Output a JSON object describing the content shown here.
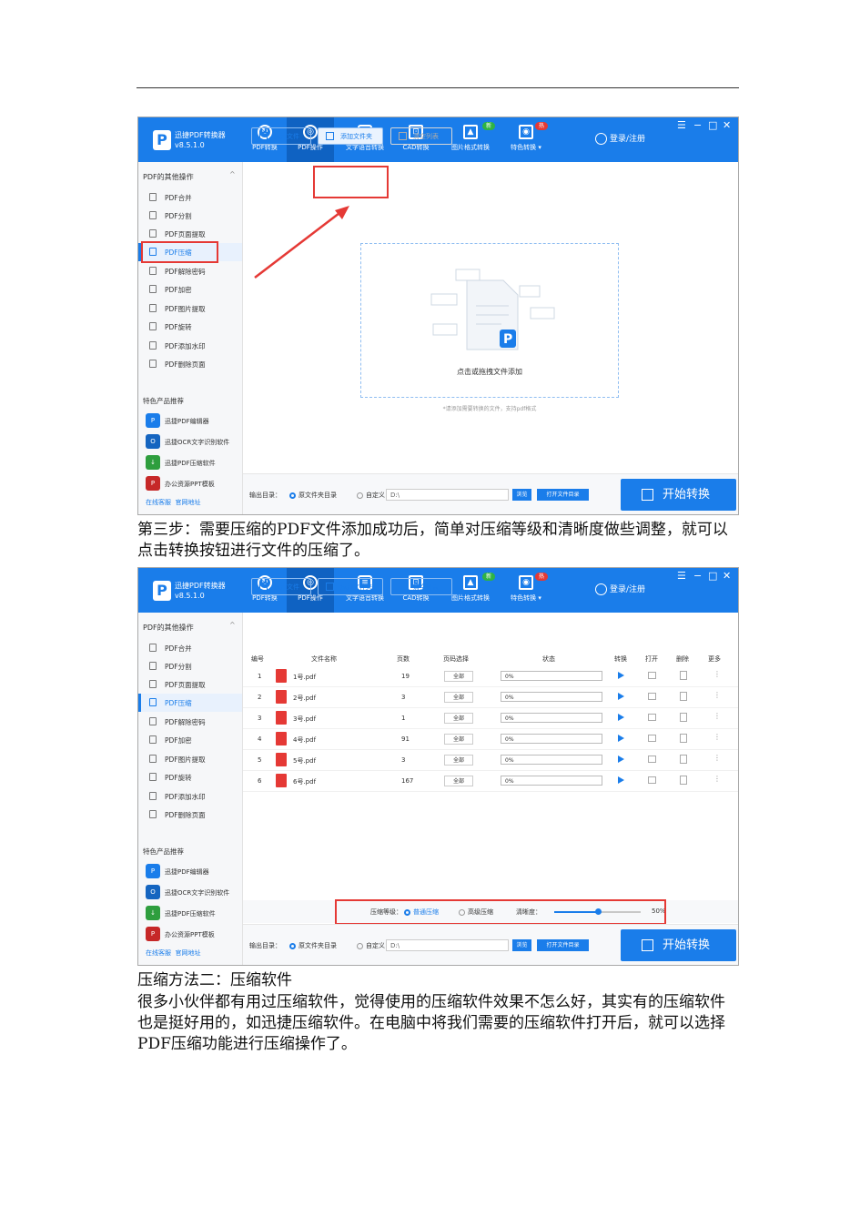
{
  "app": {
    "name": "迅捷PDF转换器",
    "version": "v8.5.1.0",
    "nav": [
      "PDF转换",
      "PDF操作",
      "文字语音转换",
      "CAD转换",
      "图片格式转换",
      "特色转换 ▾"
    ],
    "tags": [
      "新",
      "热"
    ],
    "user": "登录/注册",
    "window_controls": [
      "☰",
      "−",
      "□",
      "✕"
    ],
    "sidebar_title": "PDF的其他操作",
    "sidebar_items": [
      "PDF合并",
      "PDF分割",
      "PDF页面提取",
      "PDF压缩",
      "PDF解除密码",
      "PDF加密",
      "PDF图片提取",
      "PDF旋转",
      "PDF添加水印",
      "PDF删除页面"
    ],
    "rec_title": "特色产品推荐",
    "rec_items": [
      "迅捷PDF编辑器",
      "迅捷OCR文字识别软件",
      "迅捷PDF压缩软件",
      "办公资源PPT模板"
    ],
    "links": [
      "在线客服",
      "官网地址"
    ],
    "toolbar": {
      "add_file": "添加文件",
      "add_folder": "添加文件夹",
      "clear": "清空列表"
    },
    "drop_text": "点击或拖拽文件添加",
    "drop_hint": "*请添加需要转换的文件，支持pdf格式",
    "output_label": "输出目录：",
    "radio_src": "原文件夹目录",
    "radio_custom": "自定义：",
    "output_path": "D:\\",
    "browse": "浏览",
    "open_dir": "打开文件目录",
    "start": "开始转换"
  },
  "table": {
    "headers": [
      "编号",
      "文件名称",
      "页数",
      "页码选择",
      "状态",
      "转换",
      "打开",
      "删除",
      "更多"
    ],
    "rows": [
      {
        "no": "1",
        "name": "1号.pdf",
        "pages": "19",
        "range": "全部",
        "status": "0%"
      },
      {
        "no": "2",
        "name": "2号.pdf",
        "pages": "3",
        "range": "全部",
        "status": "0%"
      },
      {
        "no": "3",
        "name": "3号.pdf",
        "pages": "1",
        "range": "全部",
        "status": "0%"
      },
      {
        "no": "4",
        "name": "4号.pdf",
        "pages": "91",
        "range": "全部",
        "status": "0%"
      },
      {
        "no": "5",
        "name": "5号.pdf",
        "pages": "3",
        "range": "全部",
        "status": "0%"
      },
      {
        "no": "6",
        "name": "6号.pdf",
        "pages": "167",
        "range": "全部",
        "status": "0%"
      }
    ]
  },
  "compress": {
    "level_label": "压缩等级：",
    "normal": "普通压缩",
    "high": "高级压缩",
    "clarity_label": "清晰度：",
    "clarity_value": "50%",
    "clarity_fraction": 0.5
  },
  "text": {
    "step3": "第三步：需要压缩的PDF文件添加成功后，简单对压缩等级和清晰度做些调整，就可以点击转换按钮进行文件的压缩了。",
    "method2": "压缩方法二：压缩软件",
    "para": "很多小伙伴都有用过压缩软件，觉得使用的压缩软件效果不怎么好，其实有的压缩软件也是挺好用的，如迅捷压缩软件。在电脑中将我们需要的压缩软件打开后，就可以选择PDF压缩功能进行压缩操作了。"
  },
  "colors": {
    "brand": "#1a7dea",
    "highlight": "#e53935"
  }
}
